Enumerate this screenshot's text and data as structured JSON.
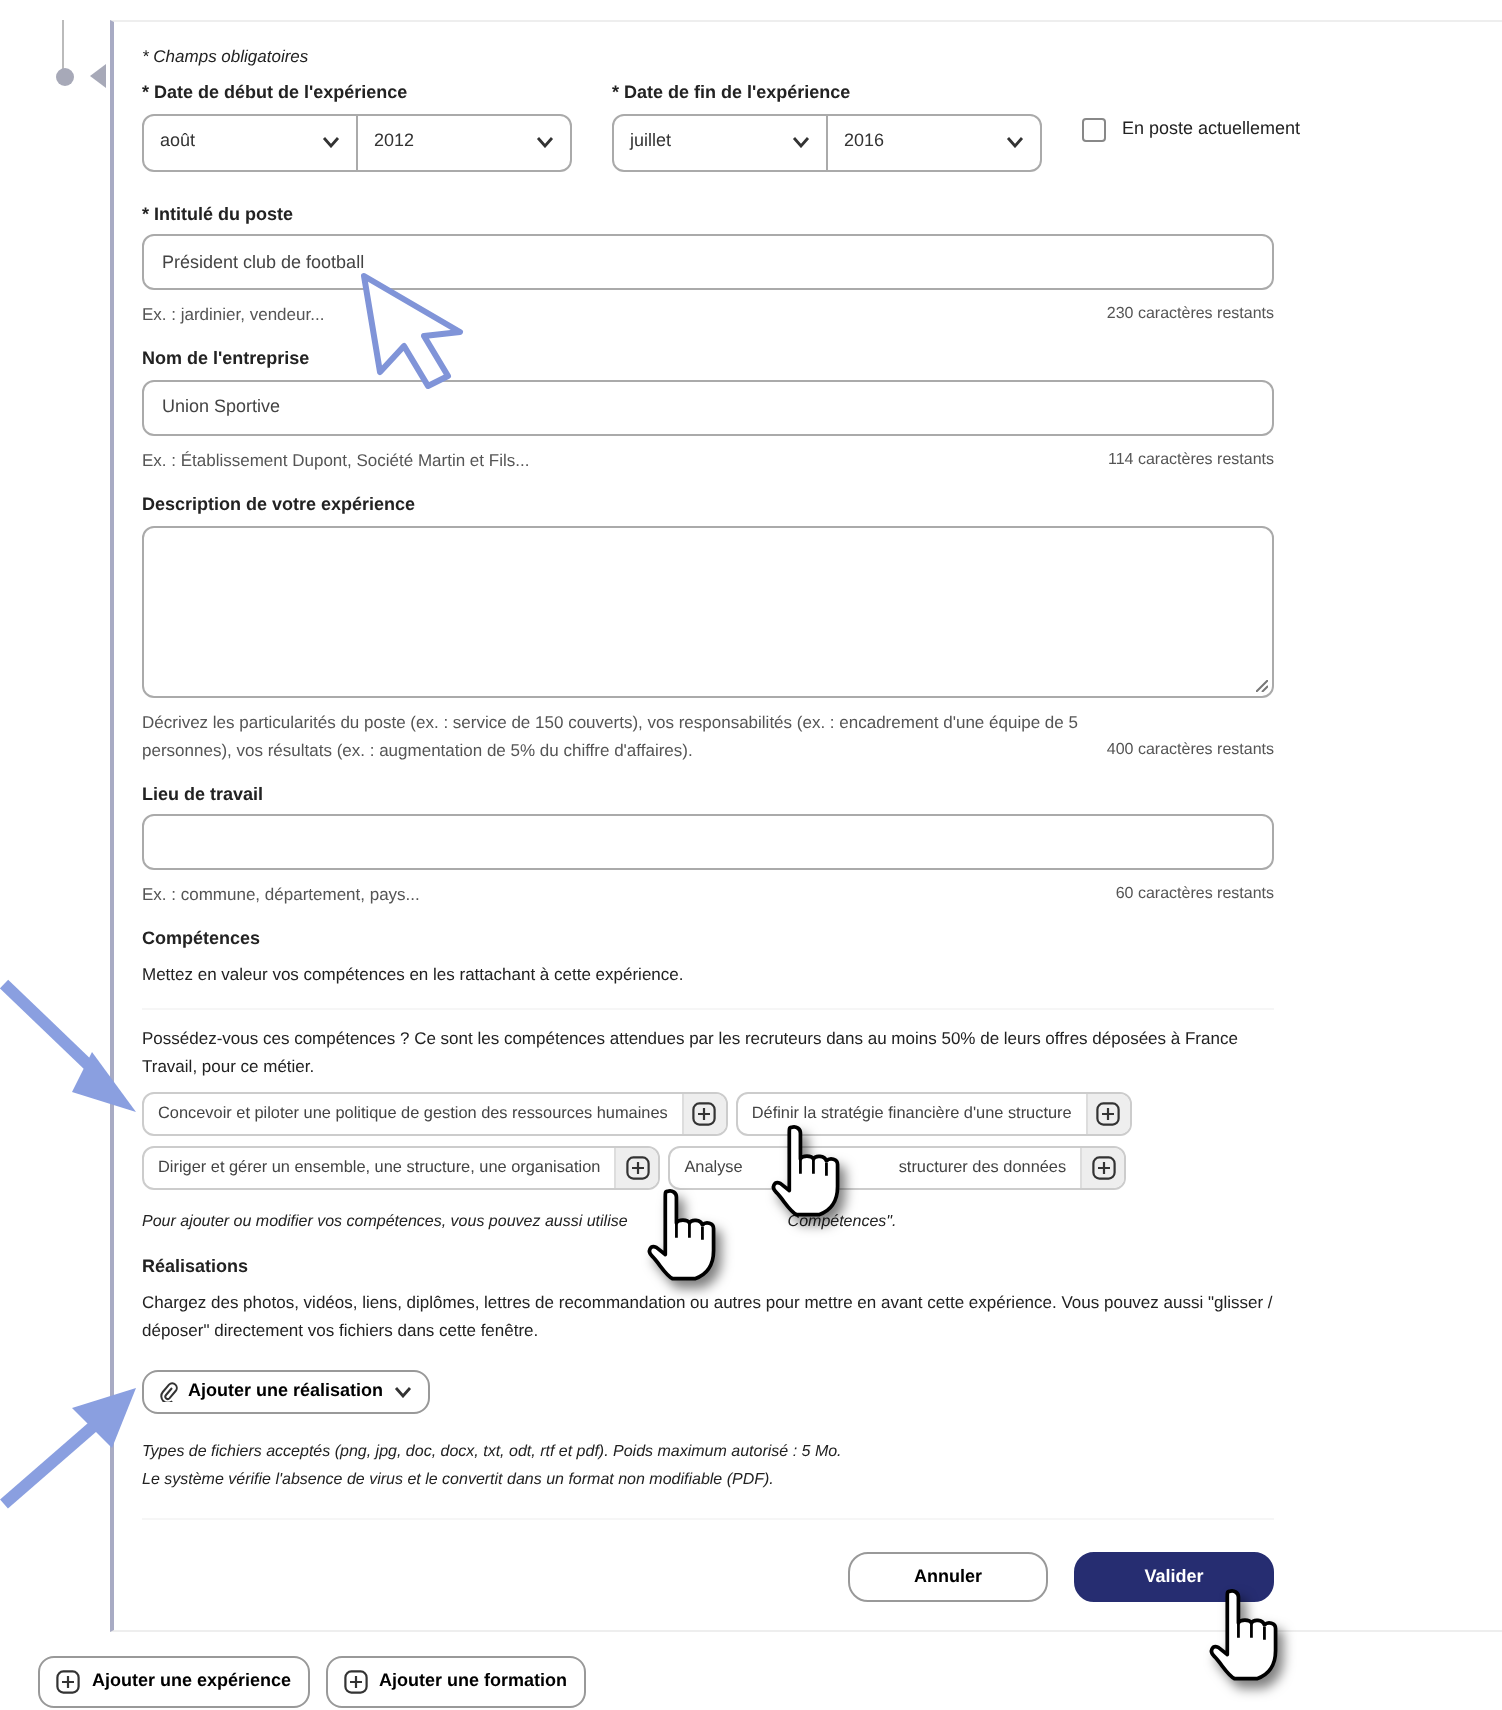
{
  "required_note": "* Champs obligatoires",
  "dates": [
    {
      "label": "* Date de début de l'expérience",
      "month": "août",
      "year": "2012"
    },
    {
      "label": "* Date de fin de l'expérience",
      "month": "juillet",
      "year": "2016"
    }
  ],
  "current_job": {
    "label": "En poste actuellement",
    "checked": false
  },
  "fields": [
    {
      "kind": "input",
      "label": "* Intitulé du poste",
      "value": "Président club de football",
      "help": "Ex. : jardinier, vendeur...",
      "counter": "230 caractères restants"
    },
    {
      "kind": "input",
      "label": "Nom de l'entreprise",
      "value": "Union Sportive",
      "help": "Ex. : Établissement Dupont, Société Martin et Fils...",
      "counter": "114 caractères restants"
    },
    {
      "kind": "textarea",
      "label": "Description de votre expérience",
      "help": "Décrivez les particularités du poste (ex. : service de 150 couverts), vos responsabilités (ex. : encadrement d'une équipe de 5 personnes), vos résultats (ex. : augmentation de 5% du chiffre d'affaires).",
      "counter": "400 caractères restants"
    },
    {
      "kind": "input",
      "label": "Lieu de travail",
      "help": "Ex. : commune, département, pays...",
      "counter": "60 caractères restants"
    }
  ],
  "skills": {
    "title": "Compétences",
    "intro": "Mettez en valeur vos compétences en les rattachant à cette expérience.",
    "question": "Possédez-vous ces compétences ? Ce sont les compétences attendues par les recruteurs dans au moins 50% de leurs offres déposées à France Travail, pour ce métier.",
    "chips": [
      {
        "label": "Concevoir et piloter une politique de gestion des ressources humaines"
      },
      {
        "label": "Définir la stratégie financière d'une structure"
      },
      {
        "label": "Diriger et gérer un ensemble, une structure, une organisation"
      },
      {
        "label": "Analyse",
        "label_end": "structurer des données"
      }
    ],
    "note": "Pour ajouter ou modifier vos compétences, vous pouvez aussi utilise",
    "note_end": "Compétences\"."
  },
  "achievements": {
    "title": "Réalisations",
    "text": "Chargez des photos, vidéos, liens, diplômes, lettres de recommandation ou autres pour mettre en avant cette expérience. Vous pouvez aussi \"glisser / déposer\" directement vos fichiers dans cette fenêtre.",
    "button": "Ajouter une réalisation",
    "file_types": "Types de fichiers acceptés (png, jpg, doc, docx, txt, odt, rtf et pdf). Poids maximum autorisé : 5 Mo.",
    "virus_note": "Le système vérifie l'absence de virus et le convertit dans un format non modifiable (PDF)."
  },
  "actions": [
    {
      "kind": "secondary",
      "label": "Annuler"
    },
    {
      "kind": "primary",
      "label": "Valider"
    }
  ],
  "bottom_buttons": [
    "Ajouter une expérience",
    "Ajouter une formation"
  ]
}
